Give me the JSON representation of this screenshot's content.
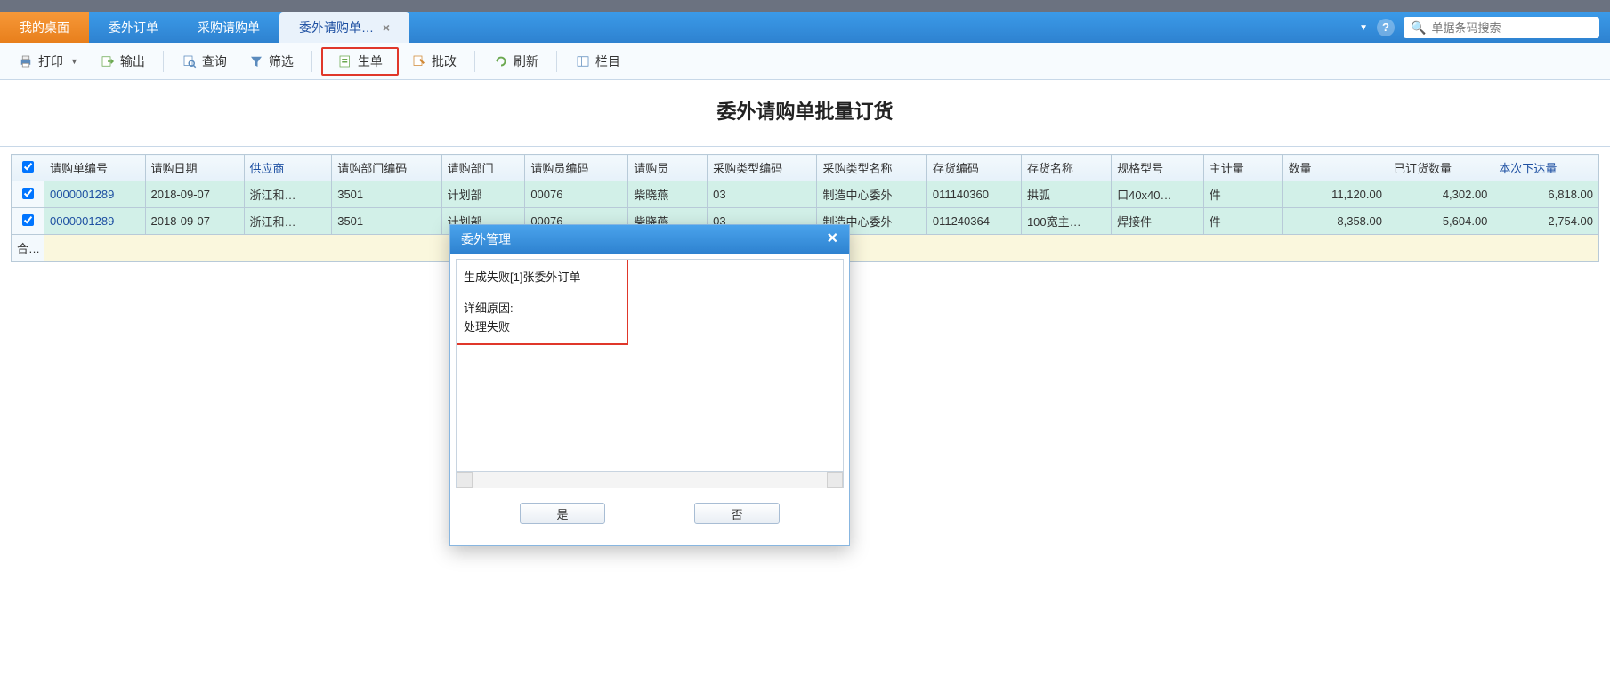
{
  "tabs": {
    "desktop": "我的桌面",
    "order": "委外订单",
    "purchase_req": "采购请购单",
    "active": "委外请购单…"
  },
  "search": {
    "placeholder": "单据条码搜索"
  },
  "toolbar": {
    "print": "打印",
    "export": "输出",
    "query": "查询",
    "filter": "筛选",
    "generate": "生单",
    "batch_edit": "批改",
    "refresh": "刷新",
    "columns": "栏目"
  },
  "page_title": "委外请购单批量订货",
  "grid": {
    "headers": {
      "req_no": "请购单编号",
      "req_date": "请购日期",
      "supplier": "供应商",
      "dept_code": "请购部门编码",
      "dept": "请购部门",
      "buyer_code": "请购员编码",
      "buyer": "请购员",
      "purchase_type_code": "采购类型编码",
      "purchase_type_name": "采购类型名称",
      "inv_code": "存货编码",
      "inv_name": "存货名称",
      "spec": "规格型号",
      "main_uom": "主计量",
      "qty": "数量",
      "ordered_qty": "已订货数量",
      "this_issue_qty": "本次下达量"
    },
    "rows": [
      {
        "req_no": "0000001289",
        "req_date": "2018-09-07",
        "supplier": "浙江和…",
        "dept_code": "3501",
        "dept": "计划部",
        "buyer_code": "00076",
        "buyer": "柴晓燕",
        "purchase_type_code": "03",
        "purchase_type_name": "制造中心委外",
        "inv_code": "011140360",
        "inv_name": "拱弧",
        "spec": "口40x40…",
        "main_uom": "件",
        "qty": "11,120.00",
        "ordered_qty": "4,302.00",
        "this_issue_qty": "6,818.00"
      },
      {
        "req_no": "0000001289",
        "req_date": "2018-09-07",
        "supplier": "浙江和…",
        "dept_code": "3501",
        "dept": "计划部",
        "buyer_code": "00076",
        "buyer": "柴晓燕",
        "purchase_type_code": "03",
        "purchase_type_name": "制造中心委外",
        "inv_code": "011240364",
        "inv_name": "100宽主…",
        "spec": "焊接件",
        "main_uom": "件",
        "qty": "8,358.00",
        "ordered_qty": "5,604.00",
        "this_issue_qty": "2,754.00"
      }
    ],
    "sum_label": "合计"
  },
  "modal": {
    "title": "委外管理",
    "line1": "生成失败[1]张委外订单",
    "line2": "详细原因:",
    "line3": "处理失败",
    "yes": "是",
    "no": "否"
  }
}
